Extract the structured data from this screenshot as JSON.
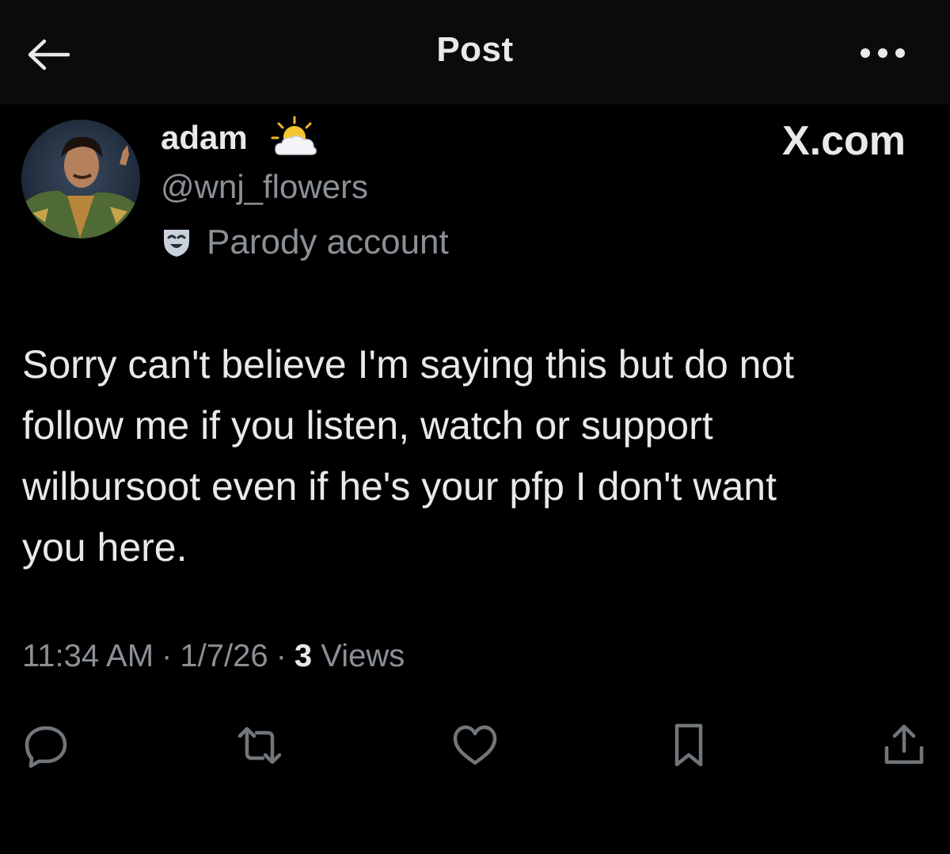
{
  "header": {
    "title": "Post",
    "back_icon": "arrow-left-icon",
    "more_icon": "more-horizontal-icon"
  },
  "author": {
    "display_name": "adam",
    "name_emoji": "sun-behind-cloud-icon",
    "handle": "@wnj_flowers",
    "badge_icon": "theater-mask-icon",
    "badge_label": "Parody account"
  },
  "source_label": "X.com",
  "post": {
    "text": "Sorry can't believe I'm saying this but do not\nfollow me if you listen, watch or support\nwilbursoot even if he's your pfp I don't want\nyou here.",
    "time": "11:34 AM",
    "date": "1/7/26",
    "separator": "·",
    "views_count": "3",
    "views_label": "Views"
  },
  "actions": [
    {
      "icon": "reply-icon"
    },
    {
      "icon": "repost-icon"
    },
    {
      "icon": "like-icon"
    },
    {
      "icon": "bookmark-icon"
    },
    {
      "icon": "share-icon"
    }
  ],
  "colors": {
    "background": "#000000",
    "topbar": "#0b0b0b",
    "primary_text": "#e7e9ea",
    "secondary_text": "#8b9096",
    "action_icon": "#71767b"
  }
}
